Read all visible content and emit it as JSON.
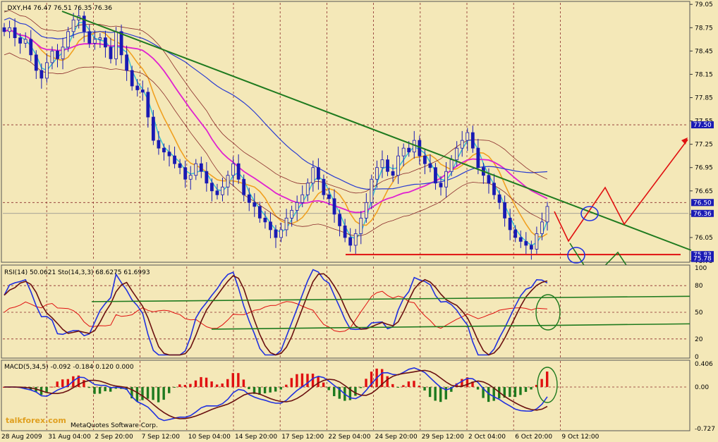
{
  "header": {
    "main": "_DXY,H4  76.47 76.51 76.35 76.36",
    "rsi": "RSI(14) 50.0621  Sto(14,3,3) 68.6275 61.6993",
    "macd": "MACD(5,34,5) -0.092 -0.184 0.120 0.000"
  },
  "watermark": {
    "site": "talkforex.com",
    "copyright": "MetaQuotes Software Corp."
  },
  "chart_data": [
    {
      "type": "candlestick",
      "symbol": "_DXY",
      "timeframe": "H4",
      "ohlc": {
        "open": 76.47,
        "high": 76.51,
        "low": 76.35,
        "close": 76.36
      },
      "ylim": [
        75.75,
        79.07
      ],
      "price_ticks": [
        "79.05",
        "78.75",
        "78.45",
        "78.15",
        "77.85",
        "77.55",
        "77.25",
        "76.95",
        "76.65",
        "76.35",
        "76.05",
        "75.75"
      ],
      "price_labels": [
        {
          "value": 77.5,
          "text": "77.50"
        },
        {
          "value": 76.5,
          "text": "76.50"
        },
        {
          "value": 76.36,
          "text": "76.36"
        },
        {
          "value": 75.83,
          "text": "75.83"
        },
        {
          "value": 75.78,
          "text": "75.78"
        }
      ],
      "time_labels": [
        "28 Aug 2009",
        "31 Aug 04:00",
        "2 Sep 20:00",
        "7 Sep 12:00",
        "10 Sep 04:00",
        "14 Sep 20:00",
        "17 Sep 12:00",
        "22 Sep 04:00",
        "24 Sep 20:00",
        "29 Sep 12:00",
        "2 Oct 04:00",
        "6 Oct 20:00",
        "9 Oct 12:00"
      ],
      "close_series": [
        78.7,
        78.75,
        78.62,
        78.55,
        78.6,
        78.4,
        78.2,
        78.1,
        78.3,
        78.45,
        78.35,
        78.5,
        78.7,
        78.85,
        78.9,
        78.7,
        78.55,
        78.6,
        78.62,
        78.5,
        78.35,
        78.7,
        78.4,
        78.2,
        78.0,
        77.95,
        77.92,
        77.6,
        77.3,
        77.2,
        77.15,
        77.1,
        77.0,
        76.95,
        76.8,
        76.85,
        77.0,
        76.9,
        76.75,
        76.65,
        76.6,
        76.7,
        76.85,
        77.0,
        76.8,
        76.6,
        76.5,
        76.45,
        76.3,
        76.25,
        76.15,
        76.05,
        76.15,
        76.3,
        76.4,
        76.5,
        76.6,
        76.75,
        76.95,
        76.8,
        76.6,
        76.55,
        76.35,
        76.2,
        76.05,
        75.95,
        76.1,
        76.3,
        76.5,
        76.8,
        76.95,
        77.05,
        76.9,
        76.85,
        77.1,
        77.2,
        77.15,
        77.3,
        77.1,
        77.0,
        76.95,
        76.75,
        76.7,
        76.9,
        77.05,
        77.2,
        77.3,
        77.4,
        77.2,
        76.95,
        76.85,
        76.75,
        76.6,
        76.5,
        76.3,
        76.15,
        76.05,
        76.0,
        75.95,
        75.9,
        76.1,
        76.25,
        76.45
      ],
      "levels": {
        "support": 75.83,
        "resistance_dashed": [
          77.5,
          76.5
        ]
      }
    },
    {
      "type": "line",
      "name": "RSI(14) / Sto(14,3,3)",
      "values": {
        "rsi": 50.0621,
        "sto_main": 68.6275,
        "sto_signal": 61.6993
      },
      "ylim": [
        0,
        100
      ],
      "ticks": [
        "100",
        "80",
        "50",
        "20",
        "0"
      ]
    },
    {
      "type": "bar",
      "name": "MACD(5,34,5)",
      "values": {
        "macd": -0.092,
        "signal": -0.184,
        "histogram": 0.12,
        "zero": 0.0
      },
      "ticks": [
        "0.406",
        "0.00",
        "-0.727"
      ]
    }
  ],
  "colors": {
    "background": "#f4e8b8",
    "candle": "#1a1ab4",
    "trend": "#1e7a1e",
    "projection_up": "#e01010",
    "projection_down": "#1e7a1e",
    "ma_orange": "#f0a020",
    "ma_magenta": "#e020d0",
    "ma_blue": "#2a3cd0",
    "label_box": "#1a1ab4",
    "label_box_red": "#e01010"
  }
}
